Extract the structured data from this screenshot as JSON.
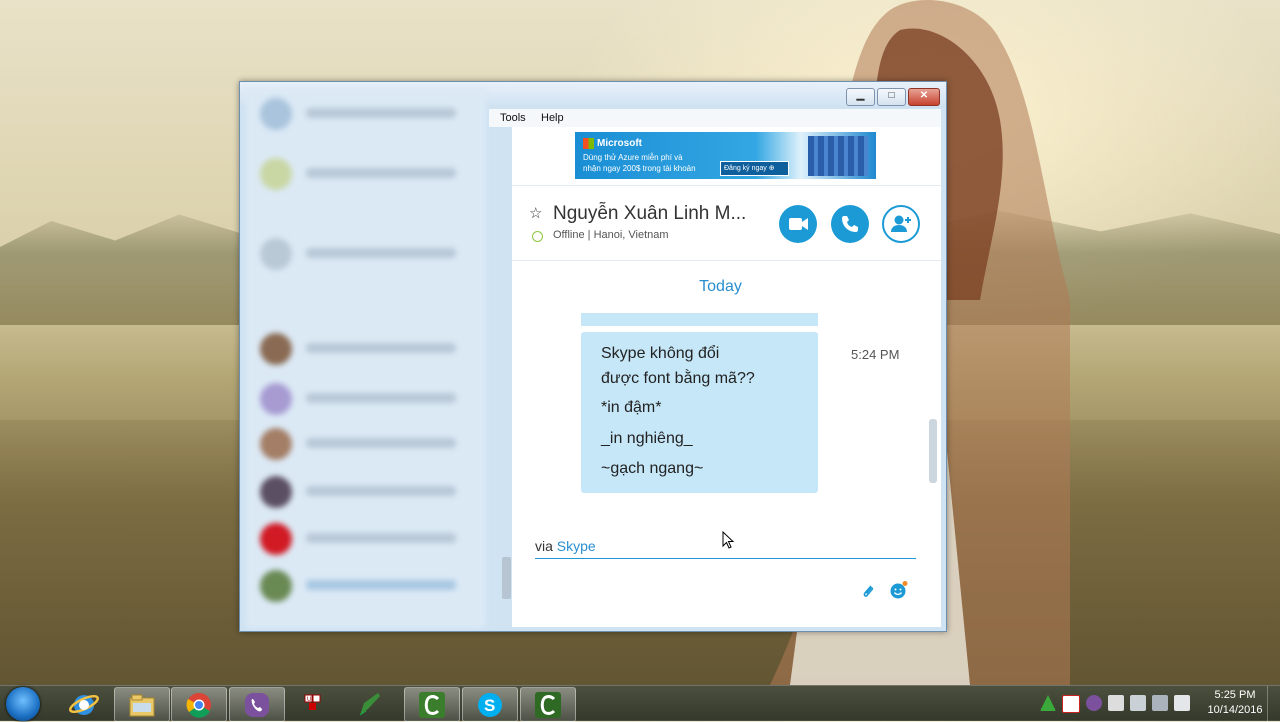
{
  "window": {
    "menu": {
      "tools": "Tools",
      "help": "Help"
    },
    "controls": {
      "minimize": "▁",
      "maximize": "□",
      "close": "✕"
    }
  },
  "ad": {
    "brand": "Microsoft",
    "line1": "Dùng thử Azure miễn phí và",
    "line2": "nhận ngay 200$ trong tài khoản",
    "cta": "Đăng ký ngay ⊕"
  },
  "contact": {
    "name": "Nguyễn Xuân Linh M...",
    "status": "Offline",
    "location": "Hanoi, Vietnam",
    "status_line": "Offline  |  Hanoi, Vietnam"
  },
  "chat": {
    "day_label": "Today",
    "message": {
      "time": "5:24 PM",
      "lines": [
        "Skype không đổi",
        "được font bằng mã??",
        "*in đậm*",
        "_in nghiêng_",
        "~gạch ngang~"
      ]
    },
    "input": {
      "prefix": "via ",
      "link": "Skype"
    }
  },
  "taskbar": {
    "clock_time": "5:25 PM",
    "clock_date": "10/14/2016"
  },
  "colors": {
    "accent": "#1c9ad6",
    "bubble": "#c6e7f8",
    "status_offline": "#8dc63f"
  },
  "icons": [
    "start-orb-icon",
    "ie-icon",
    "explorer-icon",
    "chrome-icon",
    "viber-icon",
    "unikey-icon",
    "pen-icon",
    "camtasia-icon",
    "skype-icon",
    "camtasia-recorder-icon"
  ]
}
